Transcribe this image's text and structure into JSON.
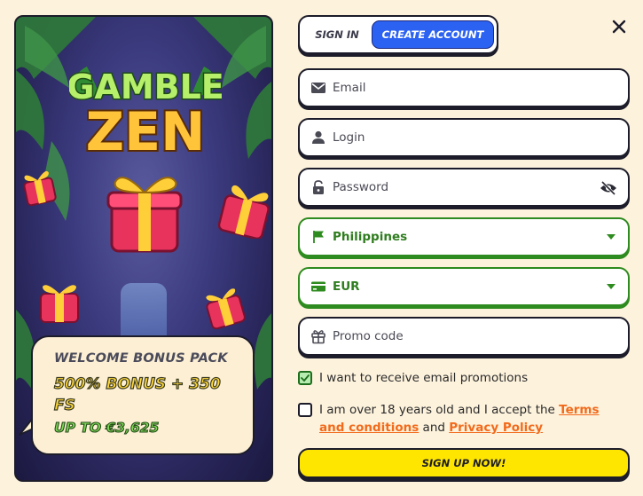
{
  "promo": {
    "logo_line1": "GAMBLE",
    "logo_line2": "ZEN",
    "bonus_title": "WELCOME BONUS PACK",
    "bonus_main": "500% BONUS + 350 FS",
    "bonus_sub": "UP TO €3,625"
  },
  "tabs": {
    "sign_in": "SIGN IN",
    "create_account": "CREATE ACCOUNT"
  },
  "form": {
    "email_placeholder": "Email",
    "login_placeholder": "Login",
    "password_placeholder": "Password",
    "country": "Philippines",
    "currency": "EUR",
    "promo_placeholder": "Promo code",
    "email_promotions_label": "I want to receive email promotions",
    "email_promotions_checked": true,
    "terms_prefix": "I am over 18 years old and I accept the ",
    "terms_link": "Terms and conditions",
    "terms_and": " and ",
    "privacy_link": "Privacy Policy",
    "terms_checked": false,
    "submit_label": "SIGN UP NOW!"
  },
  "colors": {
    "background": "#fdf2dc",
    "accent_blue": "#2b62f2",
    "accent_green": "#2e8b1f",
    "link_orange": "#f26a1b",
    "submit_yellow": "#ffe600"
  },
  "icons": [
    "envelope-icon",
    "user-icon",
    "lock-icon",
    "eye-off-icon",
    "flag-icon",
    "card-icon",
    "gift-icon",
    "close-icon",
    "caret-down-icon",
    "check-icon"
  ]
}
